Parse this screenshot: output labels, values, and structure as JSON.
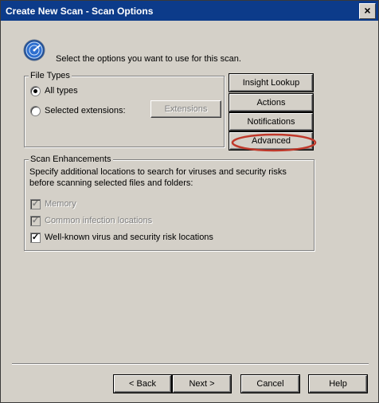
{
  "window": {
    "title": "Create New Scan - Scan Options",
    "close_glyph": "×"
  },
  "instruction": "Select the options you want to use for this scan.",
  "file_types": {
    "legend": "File Types",
    "options": [
      {
        "label": "All types",
        "selected": true
      },
      {
        "label": "Selected extensions:",
        "selected": false
      }
    ],
    "extensions_button": "Extensions"
  },
  "side_buttons": [
    "Insight Lookup",
    "Actions",
    "Notifications",
    "Advanced"
  ],
  "highlight_color": "#c0392b",
  "scan_enhancements": {
    "legend": "Scan Enhancements",
    "description_line1": "Specify additional locations to search for viruses and security risks",
    "description_line2": "before scanning selected files and folders:",
    "items": [
      {
        "label": "Memory",
        "checked": true,
        "enabled": false
      },
      {
        "label": "Common infection locations",
        "checked": true,
        "enabled": false
      },
      {
        "label": "Well-known virus and security risk locations",
        "checked": true,
        "enabled": true
      }
    ]
  },
  "footer_buttons": {
    "back": "< Back",
    "next": "Next >",
    "cancel": "Cancel",
    "help": "Help"
  },
  "check_glyph": "✓"
}
